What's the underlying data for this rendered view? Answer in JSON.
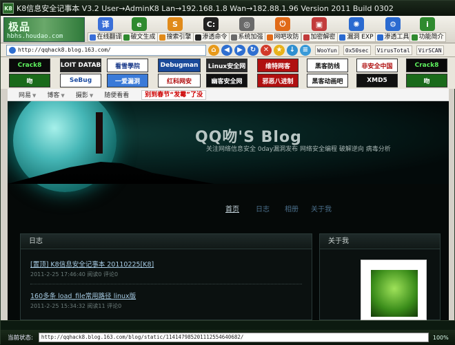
{
  "window": {
    "title": "K8信息安全记事本 V3.2   User→AdminK8  Lan→192.168.1.8  Wan→182.88.1.96  Version 2011 Build 0302",
    "logo_text": "K8",
    "logo_brand": "极品",
    "logo_url": "hbhs.houdao.com"
  },
  "toolbar": {
    "items": [
      {
        "label": "在线翻译",
        "icon": "translate-icon",
        "color": "#3a6fd8"
      },
      {
        "label": "破文生成",
        "icon": "ie-icon",
        "color": "#2f8a2f"
      },
      {
        "label": "搜索引擎",
        "icon": "shield-icon",
        "color": "#e08a1a"
      },
      {
        "label": "渗透命令",
        "icon": "terminal-icon",
        "color": "#222222"
      },
      {
        "label": "系统加强",
        "icon": "disc-icon",
        "color": "#6a6a6a"
      },
      {
        "label": "网吧攻防",
        "icon": "power-icon",
        "color": "#e06a18"
      },
      {
        "label": "加密解密",
        "icon": "lock-icon",
        "color": "#c23b3b"
      },
      {
        "label": "漏洞 EXP",
        "icon": "bug-icon",
        "color": "#2a6ad0"
      },
      {
        "label": "渗透工具",
        "icon": "tools-icon",
        "color": "#2a6ad0"
      },
      {
        "label": "功能简介",
        "icon": "info-icon",
        "color": "#2f8a2f"
      }
    ]
  },
  "address": {
    "url": "http://qqhack8.blog.163.com/",
    "quick_links": [
      "WooYun",
      "0x50sec",
      "VirusTotal",
      "VirSCAN"
    ]
  },
  "banners": [
    {
      "text": "Crack8",
      "bg": "#0a0a0a",
      "fg": "#5ef05e"
    },
    {
      "text": "EXPLOIT DATABASE",
      "bg": "#222222",
      "fg": "#ffffff"
    },
    {
      "text": "看雪學院",
      "bg": "#ffffff",
      "fg": "#1a3a8a"
    },
    {
      "text": "Debugman",
      "bg": "#1a4a9a",
      "fg": "#ffffff"
    },
    {
      "text": "Linux安全网",
      "bg": "#2a2a2a",
      "fg": "#ffffff"
    },
    {
      "text": "维特网客",
      "bg": "#b01010",
      "fg": "#ffffff"
    },
    {
      "text": "黑客防线",
      "bg": "#ffffff",
      "fg": "#111111"
    },
    {
      "text": "非安全中国",
      "bg": "#ffffff",
      "fg": "#b01010"
    },
    {
      "text": "Crack8",
      "bg": "#0a0a0a",
      "fg": "#5ef05e"
    },
    {
      "text": "吻",
      "bg": "#1a6a1a",
      "fg": "#ffffff"
    },
    {
      "text": "SeBug",
      "bg": "#ffffff",
      "fg": "#1a4aa0"
    },
    {
      "text": "一爱漏洞",
      "bg": "#3a7ad8",
      "fg": "#ffffff"
    },
    {
      "text": "红科网安",
      "bg": "#ffffff",
      "fg": "#b01010"
    },
    {
      "text": "幽客安全网",
      "bg": "#111111",
      "fg": "#ffffff"
    },
    {
      "text": "邪恶八进制",
      "bg": "#b01010",
      "fg": "#ffffff"
    },
    {
      "text": "黑客动画吧",
      "bg": "#ffffff",
      "fg": "#111111"
    },
    {
      "text": "XMD5",
      "bg": "#111111",
      "fg": "#ffffff"
    },
    {
      "text": "吻",
      "bg": "#1a6a1a",
      "fg": "#ffffff"
    }
  ],
  "blognav": {
    "items": [
      "网易",
      "博客",
      "摄影",
      "随便看看"
    ],
    "promo": "别到春节“发霉”了没"
  },
  "blog": {
    "title": "QQ吻'S Blog",
    "subtitle": "关注网络信息安全  0day漏洞发布  网络安全编程  破解逆向  病毒分析",
    "menu": [
      {
        "label": "首页",
        "active": true
      },
      {
        "label": "日志",
        "active": false
      },
      {
        "label": "相册",
        "active": false
      },
      {
        "label": "关于我",
        "active": false
      }
    ],
    "left_panel": {
      "heading": "日志",
      "entries": [
        {
          "title": "[置顶] K8信息安全记事本 20110225[K8]",
          "meta": "2011-2-25 17:46:40    阅读0    评论0"
        },
        {
          "title": "160多条  load_file常用路径  linux版",
          "meta": "2011-2-25 15:34:32    阅读11    评论0"
        }
      ]
    },
    "right_panel": {
      "heading": "关于我"
    }
  },
  "status": {
    "label": "当前状态:",
    "url": "http://qqhack8.blog.163.com/blog/static/114147985201112554640682/",
    "zoom": "100%"
  }
}
